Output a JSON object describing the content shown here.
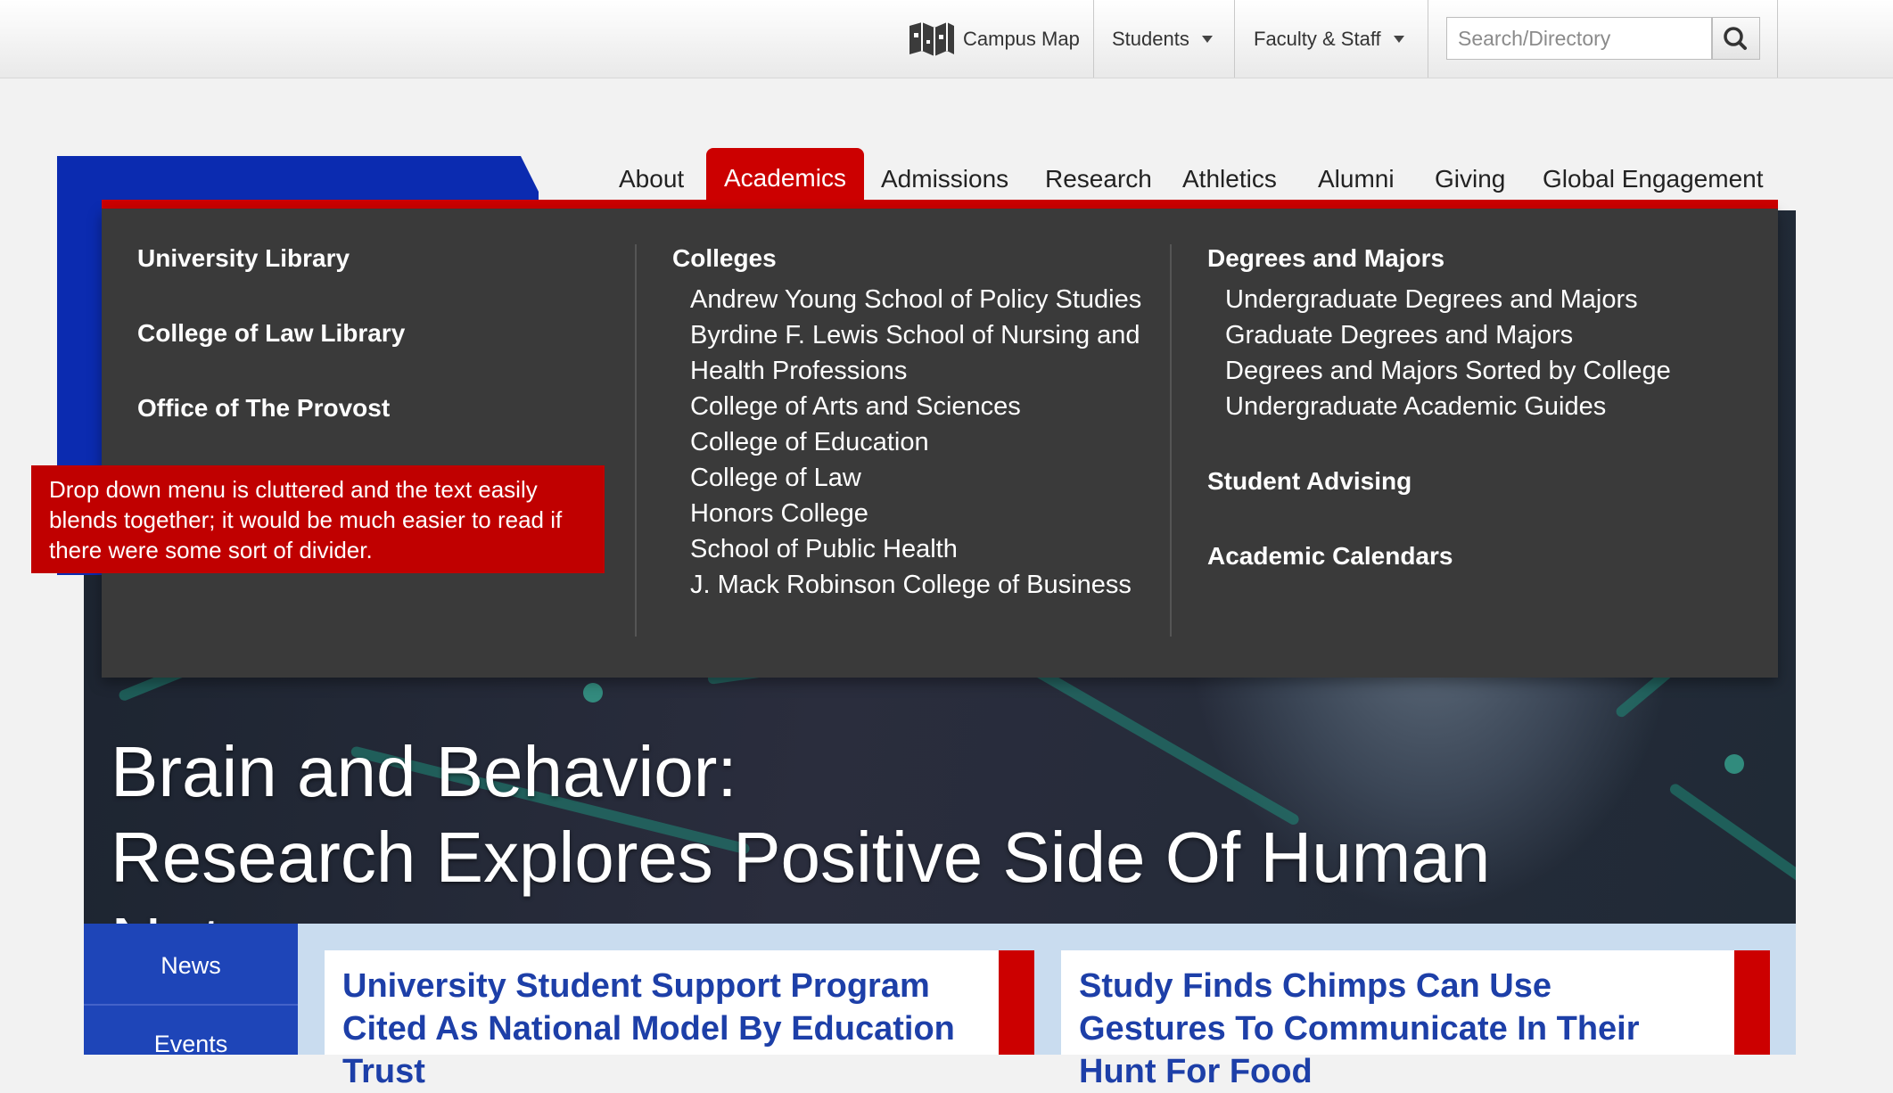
{
  "utility": {
    "campus_map": "Campus Map",
    "campus_map_icon": "map-icon",
    "students": "Students",
    "faculty_staff": "Faculty & Staff",
    "search_placeholder": "Search/Directory",
    "search_icon": "magnifier-icon"
  },
  "nav": {
    "items": [
      "About",
      "Academics",
      "Admissions",
      "Research",
      "Athletics",
      "Alumni",
      "Giving",
      "Global Engagement"
    ],
    "active": "Academics"
  },
  "dropdown": {
    "col1": [
      "University Library",
      "College of Law Library",
      "Office of The Provost"
    ],
    "colleges": {
      "heading": "Colleges",
      "links": [
        "Andrew Young School of Policy Studies",
        "Byrdine F. Lewis School of Nursing and Health Professions",
        "College of Arts and Sciences",
        "College of Education",
        "College of Law",
        "Honors College",
        "School of Public Health",
        "J. Mack Robinson College of Business"
      ]
    },
    "degrees": {
      "heading": "Degrees and Majors",
      "links": [
        "Undergraduate Degrees and Majors",
        "Graduate Degrees and Majors",
        "Degrees and Majors Sorted by College",
        "Undergraduate Academic Guides"
      ]
    },
    "student_advising": "Student Advising",
    "academic_calendars": "Academic Calendars"
  },
  "annotation": "Drop down menu is cluttered and the text easily blends together; it would be much easier to read if there were some sort of divider.",
  "hero": {
    "line1": "Brain and Behavior:",
    "line2": "Research Explores Positive Side Of Human Nature"
  },
  "subnav": {
    "news": "News",
    "events": "Events"
  },
  "cards": [
    "University Student Support Program Cited As National Model By Education Trust",
    "Study Finds Chimps Can Use Gestures To Communicate In Their Hunt For Food"
  ],
  "colors": {
    "brand_blue": "#0b2bb0",
    "accent_red": "#cc0000",
    "menu_bg": "#3a3a3a"
  }
}
